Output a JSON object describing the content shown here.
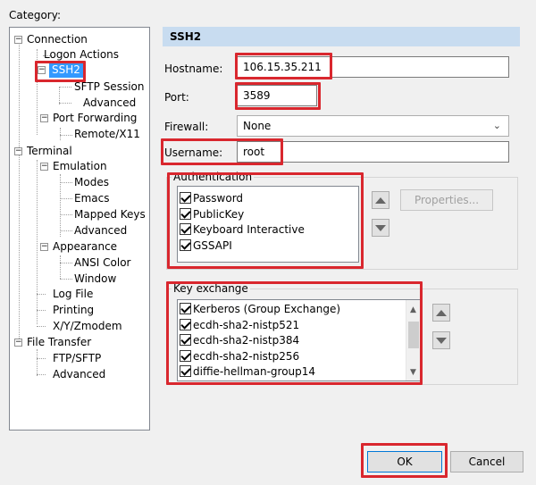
{
  "category_label": "Category:",
  "tree": {
    "items": [
      {
        "label": "Connection"
      },
      {
        "label": "Logon Actions"
      },
      {
        "label": "SSH2"
      },
      {
        "label": "SFTP Session"
      },
      {
        "label": "Advanced"
      },
      {
        "label": "Port Forwarding"
      },
      {
        "label": "Remote/X11"
      },
      {
        "label": "Terminal"
      },
      {
        "label": "Emulation"
      },
      {
        "label": "Modes"
      },
      {
        "label": "Emacs"
      },
      {
        "label": "Mapped Keys"
      },
      {
        "label": "Advanced"
      },
      {
        "label": "Appearance"
      },
      {
        "label": "ANSI Color"
      },
      {
        "label": "Window"
      },
      {
        "label": "Log File"
      },
      {
        "label": "Printing"
      },
      {
        "label": "X/Y/Zmodem"
      },
      {
        "label": "File Transfer"
      },
      {
        "label": "FTP/SFTP"
      },
      {
        "label": "Advanced"
      }
    ]
  },
  "section_title": "SSH2",
  "form": {
    "hostname_label": "Hostname:",
    "hostname_value": "106.15.35.211",
    "port_label": "Port:",
    "port_value": "3589",
    "firewall_label": "Firewall:",
    "firewall_value": "None",
    "username_label": "Username:",
    "username_value": "root"
  },
  "authentication": {
    "title": "Authentication",
    "items": [
      "Password",
      "PublicKey",
      "Keyboard Interactive",
      "GSSAPI"
    ],
    "properties_label": "Properties..."
  },
  "key_exchange": {
    "title": "Key exchange",
    "items": [
      "Kerberos (Group Exchange)",
      "ecdh-sha2-nistp521",
      "ecdh-sha2-nistp384",
      "ecdh-sha2-nistp256",
      "diffie-hellman-group14"
    ]
  },
  "buttons": {
    "ok": "OK",
    "cancel": "Cancel"
  },
  "colors": {
    "highlight": "#d9272e",
    "section_header": "#c8dcf0",
    "tree_selected": "#3399ff"
  }
}
